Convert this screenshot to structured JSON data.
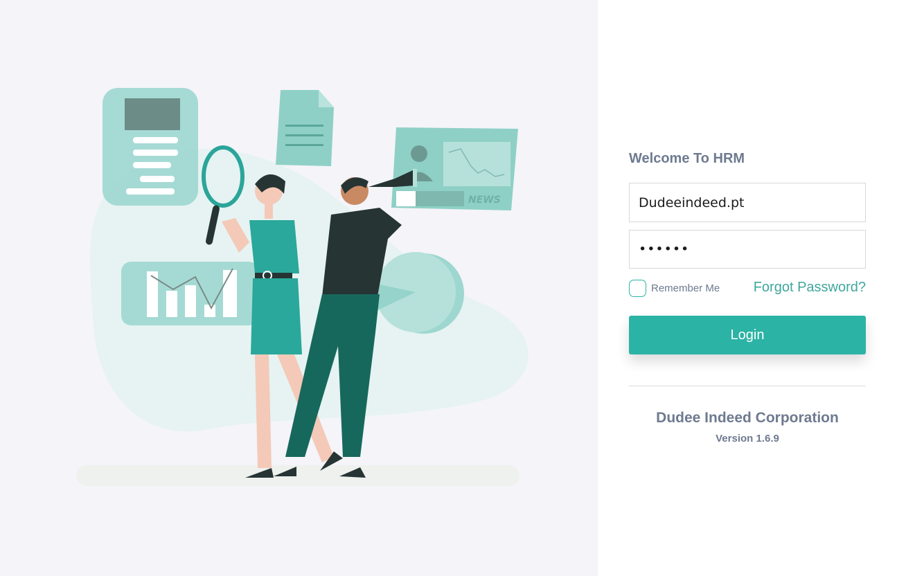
{
  "login": {
    "welcome": "Welcome To HRM",
    "username_value": "Dudeeindeed.pt",
    "password_value": "••••••",
    "remember_label": "Remember Me",
    "forgot_label": "Forgot Password?",
    "login_label": "Login"
  },
  "footer": {
    "company": "Dudee Indeed Corporation",
    "version": "Version 1.6.9"
  },
  "illustration": {
    "news_label": "NEWS"
  },
  "colors": {
    "accent": "#2bb3a5",
    "text_muted": "#6e7a8f",
    "left_bg": "#f4f4f9"
  }
}
